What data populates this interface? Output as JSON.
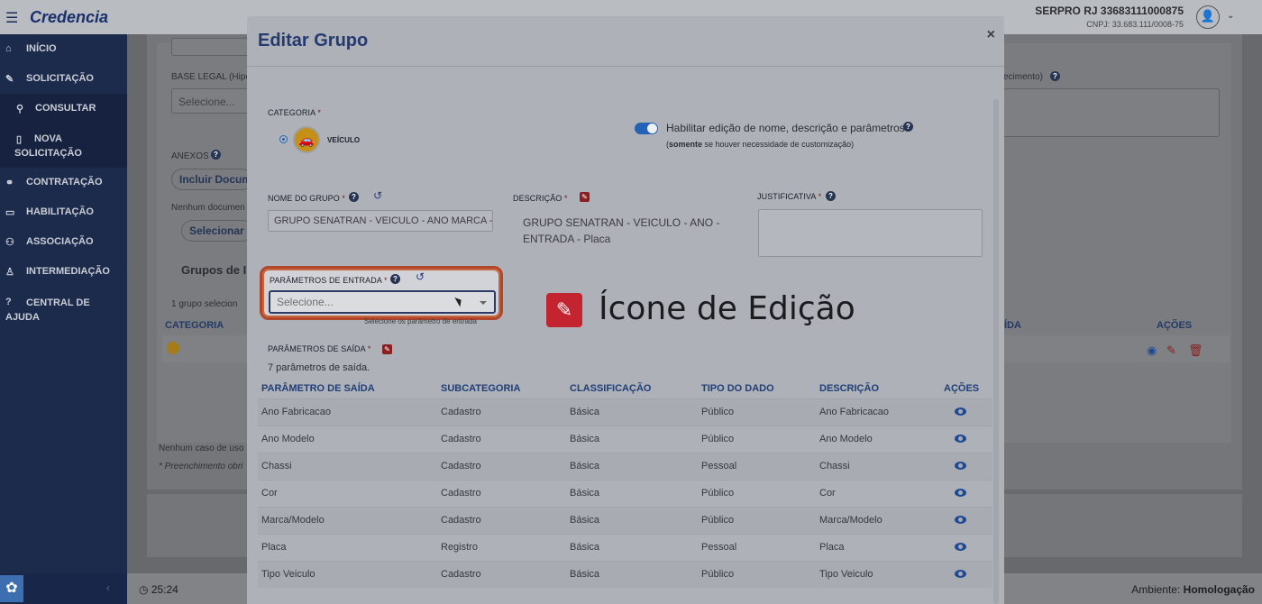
{
  "app": {
    "brand": "Credencia",
    "company": "SERPRO RJ 33683111000875",
    "cnpj": "CNPJ: 33.683.111/0008-75"
  },
  "sidebar": {
    "items": [
      {
        "label": "INÍCIO",
        "icon": "home-icon"
      },
      {
        "label": "SOLICITAÇÃO",
        "icon": "edit-icon"
      },
      {
        "label": "CONSULTAR",
        "icon": "search-icon"
      },
      {
        "label": "NOVA SOLICITAÇÃO",
        "icon": "file-icon"
      },
      {
        "label": "CONTRATAÇÃO",
        "icon": "handshake-icon"
      },
      {
        "label": "HABILITAÇÃO",
        "icon": "id-card-icon"
      },
      {
        "label": "ASSOCIAÇÃO",
        "icon": "users-icon"
      },
      {
        "label": "INTERMEDIAÇÃO",
        "icon": "user-tie-icon"
      },
      {
        "label": "CENTRAL DE AJUDA",
        "icon": "question-circle-icon"
      }
    ]
  },
  "background": {
    "base_legal_label": "BASE LEGAL (Hipó",
    "base_legal_placeholder": "Selecione...",
    "right_label_fragment": "ecimento)",
    "anexos_label": "ANEXOS",
    "incluir_btn": "Incluir Docum",
    "nenhum_doc": "Nenhum documen",
    "selecionar_btn": "Selecionar",
    "grupos_title": "Grupos de In",
    "grupo_selecionado": "1 grupo selecion",
    "col_categoria": "CATEGORIA",
    "col_saida": "ÍDA",
    "col_acoes": "AÇÕES",
    "nenhum_caso": "Nenhum caso de uso",
    "preenchimento": "* Preenchimento obri"
  },
  "footer": {
    "timer": "25:24",
    "ambiente_label": "Ambiente:",
    "ambiente_value": "Homologação"
  },
  "modal": {
    "title": "Editar Grupo",
    "close": "×",
    "categoria_label": "CATEGORIA",
    "categoria_value": "VEÍCULO",
    "toggle_label": "Habilitar edição de nome, descrição e parâmetros",
    "toggle_help_bold": "somente",
    "toggle_help_rest": " se houver necessidade de customização)",
    "nome_label": "NOME DO GRUPO",
    "nome_value": "GRUPO SENATRAN - VEICULO - ANO MARCA - E",
    "descricao_label": "DESCRIÇÃO",
    "descricao_line1": "GRUPO SENATRAN - VEICULO - ANO -",
    "descricao_line2": "ENTRADA - Placa",
    "justificativa_label": "JUSTIFICATIVA",
    "entrada_label": "PARÂMETROS DE ENTRADA",
    "entrada_placeholder": "Selecione...",
    "entrada_help": "Selecione os parâmetro de entrada",
    "saida_label": "PARÂMETROS DE SAÍDA",
    "saida_count": "7 parâmetros de saída.",
    "table": {
      "headers": [
        "PARÂMETRO DE SAÍDA",
        "SUBCATEGORIA",
        "CLASSIFICAÇÃO",
        "TIPO DO DADO",
        "DESCRIÇÃO",
        "AÇÕES"
      ],
      "rows": [
        [
          "Ano Fabricacao",
          "Cadastro",
          "Básica",
          "Público",
          "Ano Fabricacao"
        ],
        [
          "Ano Modelo",
          "Cadastro",
          "Básica",
          "Público",
          "Ano Modelo"
        ],
        [
          "Chassi",
          "Cadastro",
          "Básica",
          "Pessoal",
          "Chassi"
        ],
        [
          "Cor",
          "Cadastro",
          "Básica",
          "Público",
          "Cor"
        ],
        [
          "Marca/Modelo",
          "Cadastro",
          "Básica",
          "Público",
          "Marca/Modelo"
        ],
        [
          "Placa",
          "Registro",
          "Básica",
          "Pessoal",
          "Placa"
        ],
        [
          "Tipo Veiculo",
          "Cadastro",
          "Básica",
          "Público",
          "Tipo Veiculo"
        ]
      ]
    }
  },
  "callout": {
    "text": "Ícone de Edição",
    "icon": "pencil-icon"
  },
  "colors": {
    "sidebar": "#1c2a4c",
    "accent": "#2462b8",
    "edit_red": "#c4242f",
    "highlight_border": "#b1462a"
  }
}
